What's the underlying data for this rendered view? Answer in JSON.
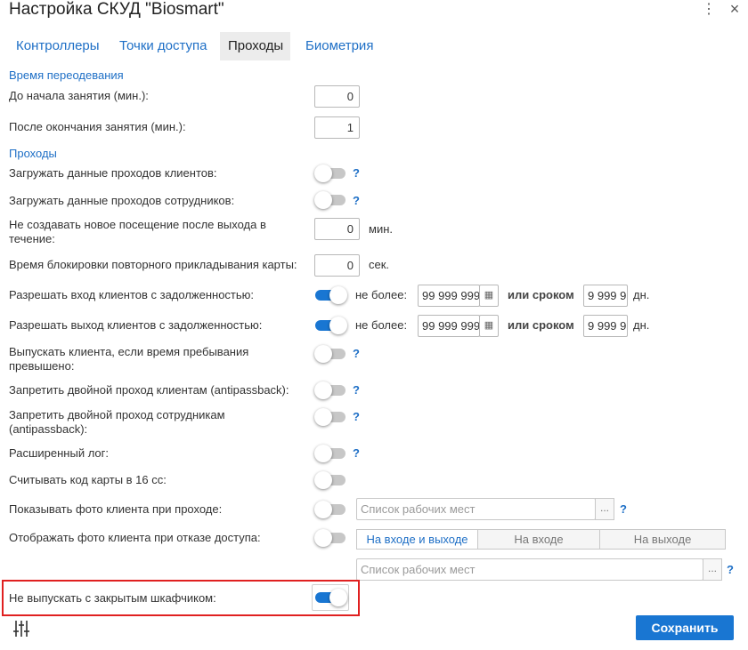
{
  "title": "Настройка СКУД \"Biosmart\"",
  "tabs": {
    "controllers": "Контроллеры",
    "access_points": "Точки доступа",
    "passes": "Проходы",
    "biometry": "Биометрия"
  },
  "changing_time": {
    "section_label": "Время переодевания",
    "before_label": "До начала занятия (мин.):",
    "before_value": "0",
    "after_label": "После окончания занятия (мин.):",
    "after_value": "1"
  },
  "passes": {
    "section_label": "Проходы",
    "load_clients_label": "Загружать данные проходов клиентов:",
    "load_clients_on": false,
    "load_staff_label": "Загружать данные проходов сотрудников:",
    "load_staff_on": false,
    "no_new_visit_label": "Не создавать новое посещение после выхода в течение:",
    "no_new_visit_value": "0",
    "no_new_visit_unit": "мин.",
    "block_repeat_label": "Время блокировки повторного прикладывания карты:",
    "block_repeat_value": "0",
    "block_repeat_unit": "сек.",
    "allow_entry_debt_label": "Разрешать вход клиентов с задолженностью:",
    "allow_entry_debt_on": true,
    "allow_exit_debt_label": "Разрешать выход клиентов с задолженностью:",
    "allow_exit_debt_on": true,
    "no_more_label": "не более:",
    "debt_amount_entry": "99 999 999",
    "debt_amount_exit": "99 999 999",
    "or_term_label": "или сроком",
    "debt_days_entry": "9 999 9",
    "debt_days_exit": "9 999 9",
    "days_unit": "дн.",
    "release_overtime_label": "Выпускать клиента, если время пребывания превышено:",
    "release_overtime_on": false,
    "antipassback_clients_label": "Запретить двойной проход клиентам (antipassback):",
    "antipassback_clients_on": false,
    "antipassback_staff_label": "Запретить двойной проход сотрудникам (antipassback):",
    "antipassback_staff_on": false,
    "extended_log_label": "Расширенный лог:",
    "extended_log_on": false,
    "hex_code_label": "Считывать код карты в 16 сс:",
    "hex_code_on": false,
    "show_photo_label": "Показывать фото клиента при проходе:",
    "show_photo_on": false,
    "workplaces_placeholder": "Список рабочих мест",
    "show_photo_denied_label": "Отображать фото клиента при отказе доступа:",
    "show_photo_denied_on": false,
    "seg_both": "На входе и выходе",
    "seg_entry": "На входе",
    "seg_exit": "На выходе",
    "workplaces_placeholder_2": "Список рабочих мест",
    "locked_locker_label": "Не выпускать с закрытым шкафчиком:",
    "locked_locker_on": true
  },
  "ellipsis": "...",
  "help": "?",
  "save_label": "Сохранить",
  "colors": {
    "accent": "#1976d2",
    "link": "#1e6fc6",
    "highlight_border": "#e02020"
  },
  "icons": {
    "menu": "vertical-dots-icon",
    "close": "close-icon",
    "calendar": "calendar-icon",
    "settings": "sliders-icon"
  }
}
